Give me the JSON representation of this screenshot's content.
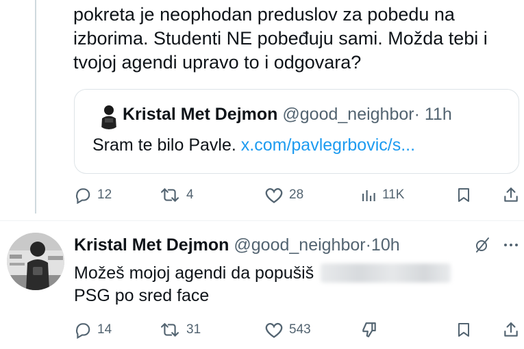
{
  "tweet": {
    "lines": [
      "pokreta je neophodan preduslov za pobedu na",
      "izborima. Studenti NE pobeđuju sami. Možda tebi i",
      "tvojoj agendi upravo to i odgovara?"
    ],
    "quote": {
      "name": "Kristal Met Dejmon",
      "handle": "@good_neighbor",
      "dot": "·",
      "time": "11h",
      "text": "Sram te bilo Pavle.",
      "link": "x.com/pavlegrbovic/s..."
    },
    "actions": {
      "replies": "12",
      "reposts": "4",
      "likes": "28",
      "views": "11K"
    }
  },
  "reply": {
    "name": "Kristal Met Dejmon",
    "handle": "@good_neighbor",
    "dot": "·",
    "time": "10h",
    "text_line1": "Možeš mojoj agendi da popušiš",
    "text_line2": "PSG po sred face",
    "actions": {
      "replies": "14",
      "reposts": "31",
      "likes": "543"
    }
  },
  "icons": {
    "reply": "reply-bubble-icon",
    "repost": "repost-icon",
    "like": "heart-icon",
    "views": "views-bar-chart-icon",
    "bookmark": "bookmark-icon",
    "share": "share-icon",
    "dislike": "downvote-icon",
    "grok": "grok-icon",
    "more": "more-icon"
  },
  "colors": {
    "text": "#0f1419",
    "secondary": "#536471",
    "link": "#1d9bf0",
    "border": "#dde3e7"
  }
}
